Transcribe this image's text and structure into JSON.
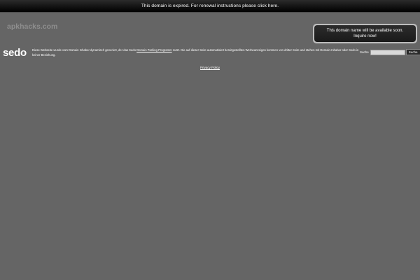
{
  "banner": {
    "text": "This domain is expired. For renewal instructions please click here."
  },
  "domain": {
    "name": "apkhacks.com"
  },
  "inquire": {
    "line1": "This domain name will be available soon.",
    "line2": "Inquire now!"
  },
  "sedo": {
    "logo": "sedo",
    "disclaimer_pre": "Diese Webseite wurde vom Domain Inhaber dynamisch generiert, der das Sedo ",
    "disclaimer_link": "Domain Parking Programm",
    "disclaimer_post": " nutzt. Die auf dieser Seite automatisiert bereitgestellten Werbeanzeigen kommen von dritter Seite und stehen mit Domain-Inhaber oder Sedo in keiner Beziehung."
  },
  "search": {
    "label": "Suche",
    "value": "",
    "button_label": "Suche"
  },
  "footer": {
    "privacy_label": "Privacy Policy"
  },
  "colors": {
    "background": "#656565",
    "banner": "#111111",
    "text": "#ffffff",
    "domain_text": "#8e8e8e"
  }
}
